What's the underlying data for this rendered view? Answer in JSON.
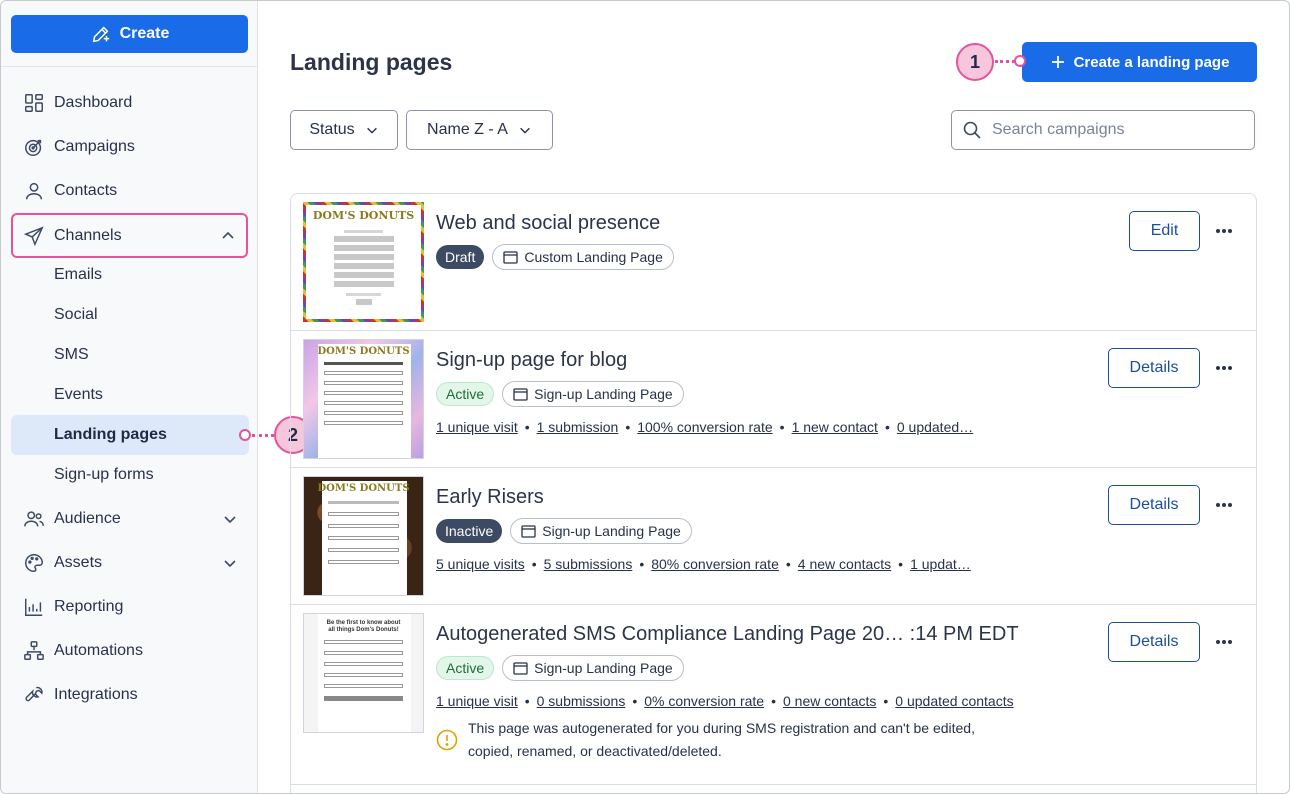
{
  "sidebar": {
    "create_label": "Create",
    "nav": [
      {
        "label": "Dashboard",
        "icon": "dashboard-icon"
      },
      {
        "label": "Campaigns",
        "icon": "target-icon"
      },
      {
        "label": "Contacts",
        "icon": "person-icon"
      },
      {
        "label": "Channels",
        "icon": "paper-plane-icon",
        "expanded": true
      },
      {
        "label": "Audience",
        "icon": "people-icon"
      },
      {
        "label": "Assets",
        "icon": "palette-icon"
      },
      {
        "label": "Reporting",
        "icon": "chart-icon"
      },
      {
        "label": "Automations",
        "icon": "flow-icon"
      },
      {
        "label": "Integrations",
        "icon": "wrench-icon"
      }
    ],
    "channels_sub": [
      "Emails",
      "Social",
      "SMS",
      "Events",
      "Landing pages",
      "Sign-up forms"
    ],
    "active_sub": "Landing pages"
  },
  "callouts": {
    "one": "1",
    "two": "2"
  },
  "header": {
    "title": "Landing pages",
    "create_button": "Create a landing page"
  },
  "filters": {
    "status": "Status",
    "sort": "Name Z - A",
    "search_placeholder": "Search campaigns"
  },
  "pages": [
    {
      "title": "Web and social presence",
      "status": "Draft",
      "type": "Custom Landing Page",
      "action": "Edit",
      "stats": []
    },
    {
      "title": "Sign-up page for blog",
      "status": "Active",
      "type": "Sign-up Landing Page",
      "action": "Details",
      "stats": [
        "1 unique visit",
        "1 submission",
        "100% conversion rate",
        "1 new contact",
        "0 updated…"
      ]
    },
    {
      "title": "Early Risers",
      "status": "Inactive",
      "type": "Sign-up Landing Page",
      "action": "Details",
      "stats": [
        "5 unique visits",
        "5 submissions",
        "80% conversion rate",
        "4 new contacts",
        "1 updat…"
      ]
    },
    {
      "title": "Autogenerated SMS Compliance Landing Page 20… :14 PM EDT",
      "status": "Active",
      "type": "Sign-up Landing Page",
      "action": "Details",
      "stats": [
        "1 unique visit",
        "0 submissions",
        "0% conversion rate",
        "0 new contacts",
        "0 updated contacts"
      ],
      "warning": "This page was autogenerated for you during SMS registration and can't be edited, copied, renamed, or deactivated/deleted."
    }
  ],
  "thumbnails": {
    "brand": "DOM'S DONUTS",
    "sms_heading": "Be the first to know about all things Dom's Donuts!"
  },
  "colors": {
    "primary": "#1a6be8",
    "highlight": "#e6539a",
    "active_bg": "#dde9f9"
  }
}
